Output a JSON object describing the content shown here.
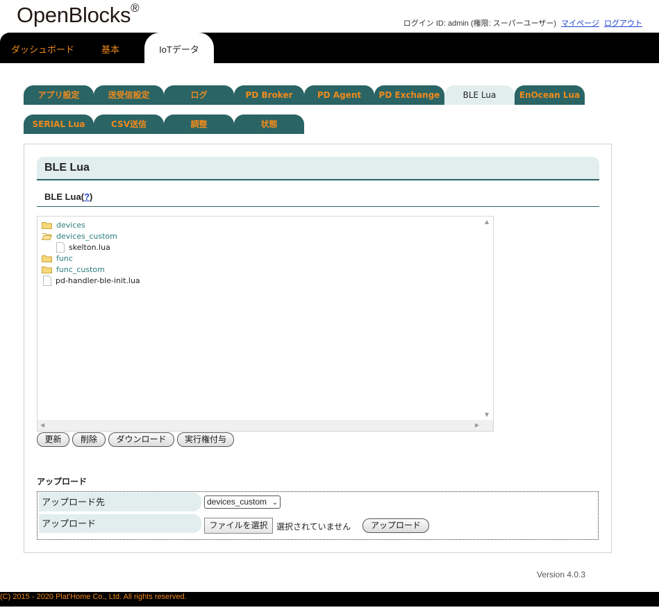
{
  "header": {
    "logo": "OpenBlocks",
    "logo_mark": "®",
    "login_info": "ログイン ID: admin (権限: スーパーユーザー)",
    "mypage": "マイページ",
    "logout": "ログアウト"
  },
  "topnav": {
    "dashboard": "ダッシュボード",
    "basic": "基本",
    "iot": "IoTデータ"
  },
  "subtabs": {
    "app_settings": "アプリ設定",
    "send_recv": "送受信設定",
    "log": "ログ",
    "pd_broker": "PD Broker",
    "pd_agent": "PD Agent",
    "pd_exchange": "PD Exchange",
    "ble_lua": "BLE Lua",
    "enocean_lua": "EnOcean Lua",
    "serial_lua": "SERIAL Lua",
    "csv_send": "CSV送信",
    "adjust": "調整",
    "status": "状態"
  },
  "panel": {
    "title": "BLE Lua",
    "section_label": "BLE Lua(",
    "section_help": "?",
    "section_close": ")"
  },
  "tree": {
    "items": [
      {
        "label": "devices",
        "kind": "folder"
      },
      {
        "label": "devices_custom",
        "kind": "folder-open"
      },
      {
        "label": "skelton.lua",
        "kind": "file"
      },
      {
        "label": "func",
        "kind": "folder"
      },
      {
        "label": "func_custom",
        "kind": "folder"
      },
      {
        "label": "pd-handler-ble-init.lua",
        "kind": "file"
      }
    ]
  },
  "buttons": {
    "refresh": "更新",
    "delete": "削除",
    "download": "ダウンロード",
    "grant_exec": "実行権付与"
  },
  "upload": {
    "heading": "アップロード",
    "dest_label": "アップロード先",
    "dest_value": "devices_custom",
    "file_label": "アップロード",
    "choose_file": "ファイルを選択",
    "no_file": "選択されていません",
    "upload_button": "アップロード"
  },
  "version": "Version 4.0.3",
  "footer": "(C) 2015 - 2020 Plat'Home Co., Ltd. All rights reserved.",
  "colors": {
    "tab_teal": "#2a6464",
    "accent_orange": "#f08a1c",
    "pale_teal": "#e2eeee"
  }
}
